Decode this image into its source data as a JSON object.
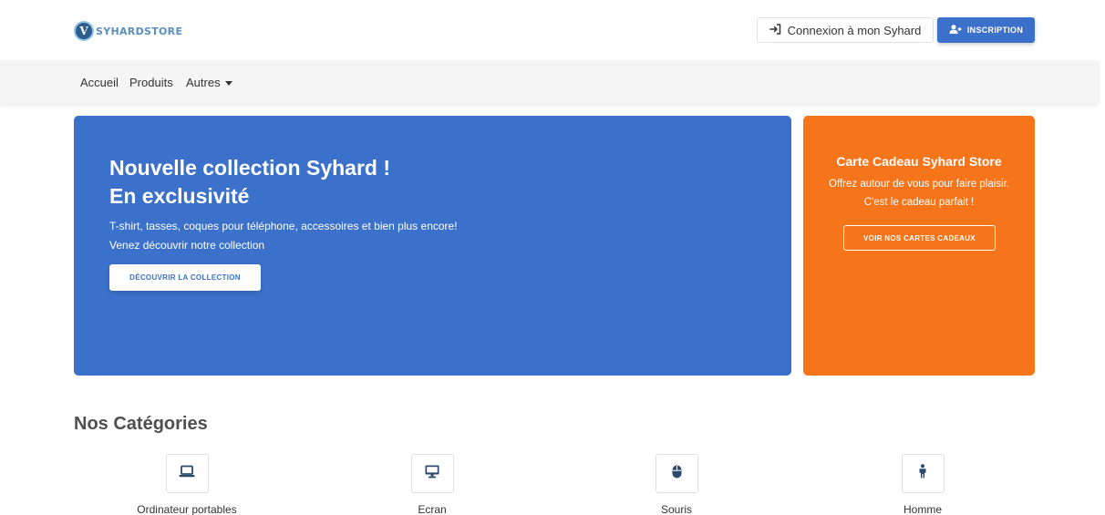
{
  "brand": {
    "logo_letter": "V",
    "logo_text": "SYHARDSTORE"
  },
  "header": {
    "login_label": "Connexion à mon Syhard",
    "signup_label": "INSCRIPTION"
  },
  "nav": {
    "items": [
      {
        "label": "Accueil"
      },
      {
        "label": "Produits"
      },
      {
        "label": "Autres"
      }
    ]
  },
  "hero": {
    "title_line1": "Nouvelle collection Syhard !",
    "title_line2": "En exclusivité",
    "desc": "T-shirt, tasses, coques pour téléphone, accessoires et bien plus encore! Venez découvrir notre collection",
    "button_label": "DÉCOUVRIR LA COLLECTION"
  },
  "gift": {
    "title": "Carte Cadeau Syhard Store",
    "line1": "Offrez autour de vous pour faire plaisir.",
    "line2": "C'est le cadeau parfait !",
    "button_label": "VOIR NOS CARTES CADEAUX"
  },
  "categories": {
    "heading": "Nos Catégories",
    "items": [
      {
        "label": "Ordinateur portables",
        "icon": "laptop-icon"
      },
      {
        "label": "Ecran",
        "icon": "desktop-icon"
      },
      {
        "label": "Souris",
        "icon": "mouse-icon"
      },
      {
        "label": "Homme",
        "icon": "person-icon"
      }
    ]
  },
  "colors": {
    "primary": "#3b71ca",
    "orange": "#f6741a",
    "navbar_bg": "#f5f5f5",
    "icon_color": "#2c4a6e"
  }
}
